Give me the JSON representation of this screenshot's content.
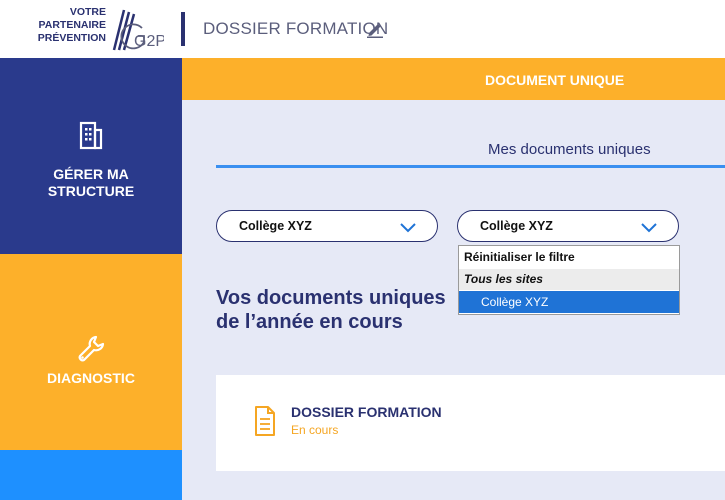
{
  "colors": {
    "navy": "#2a3a8c",
    "orange": "#fdb02a",
    "accent_blue": "#1e90ff",
    "highlight_blue": "#1f73d6",
    "main_bg": "#e6e9f6",
    "text_navy": "#2a3170"
  },
  "header": {
    "logo_lines": [
      "VOTRE",
      "PARTENAIRE",
      "PRÉVENTION"
    ],
    "logo_mark": "G2P",
    "title": "DOSSIER FORMATION",
    "edit_icon": "pencil-icon"
  },
  "sidebar": {
    "items": [
      {
        "label_line1": "GÉRER MA",
        "label_line2": "STRUCTURE",
        "icon": "building-icon"
      },
      {
        "label_line1": "DIAGNOSTIC",
        "icon": "wrench-icon"
      }
    ]
  },
  "main": {
    "topbar_title": "DOCUMENT UNIQUE",
    "subtab": "Mes documents uniques",
    "filters": [
      {
        "value": "Collège XYZ"
      },
      {
        "value": "Collège XYZ"
      }
    ],
    "dropdown": {
      "options": [
        "Réinitialiser le filtre",
        "Tous les sites",
        "Collège XYZ"
      ],
      "selected": "Collège XYZ"
    },
    "heading_line1": "Vos documents uniques",
    "heading_line2": "de l’année en cours",
    "documents": [
      {
        "title": "DOSSIER FORMATION",
        "status": "En cours",
        "icon": "document-icon"
      }
    ]
  }
}
